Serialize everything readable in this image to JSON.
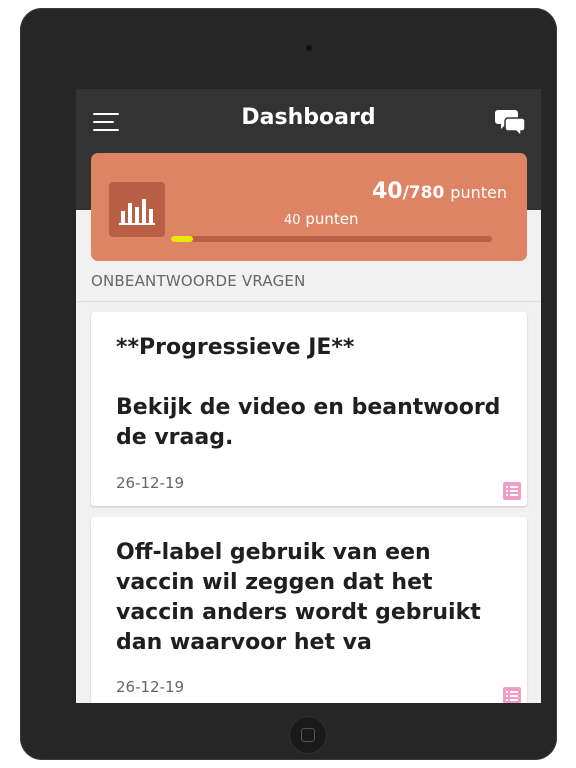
{
  "header": {
    "title": "Dashboard",
    "menu_icon": "hamburger-menu-icon",
    "chat_icon": "chat-bubbles-icon"
  },
  "points": {
    "current": "40",
    "max": "/780",
    "unit": "punten",
    "sub_value": "40",
    "sub_unit": "punten",
    "progress_fraction": 0.0513,
    "icon": "bar-chart-icon"
  },
  "section": {
    "title": "ONBEANTWOORDE VRAGEN"
  },
  "questions": [
    {
      "title": "**Progressieve JE**\n\nBekijk de video en beantwoord de vraag.",
      "date": "26-12-19",
      "icon": "list-icon"
    },
    {
      "title": "Off-label gebruik van een vaccin wil zeggen dat het vaccin anders wordt gebruikt dan waarvoor het va",
      "date": "26-12-19",
      "icon": "list-icon"
    }
  ],
  "colors": {
    "header_bg": "#333333",
    "card_accent": "#de8465",
    "icon_tile": "#b95f46",
    "progress_fill": "#e8e80f",
    "list_icon": "#f59bc8",
    "device_frame": "#262626"
  }
}
